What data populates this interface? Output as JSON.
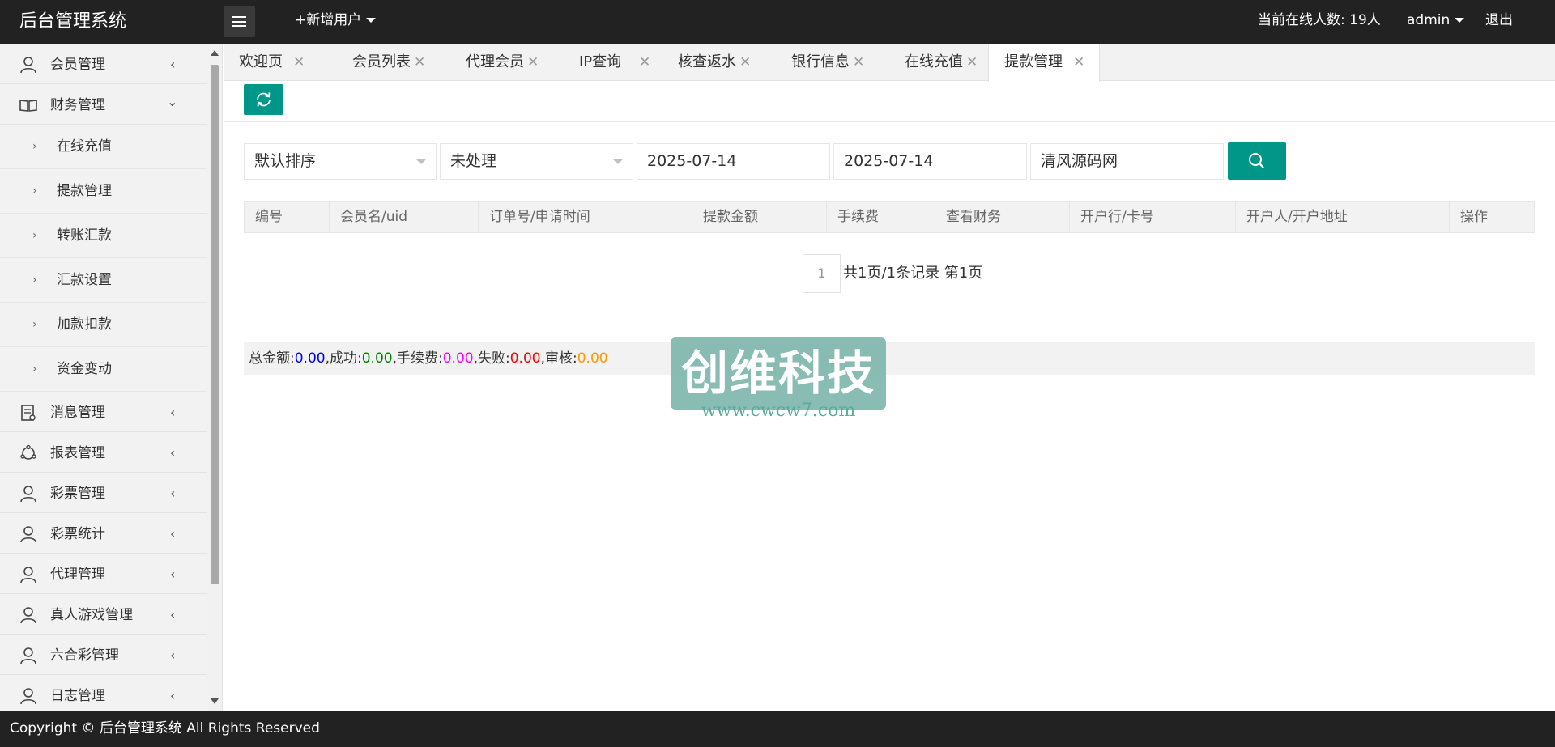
{
  "header": {
    "logo": "后台管理系统",
    "add_user": "+新增用户",
    "online_count": "当前在线人数: 19人",
    "admin": "admin",
    "logout": "退出"
  },
  "sidebar": {
    "items": [
      {
        "label": "会员管理",
        "icon": "user-icon"
      },
      {
        "label": "财务管理",
        "icon": "book-icon"
      },
      {
        "label": "消息管理",
        "icon": "document-icon"
      },
      {
        "label": "报表管理",
        "icon": "cycle-icon"
      },
      {
        "label": "彩票管理",
        "icon": "user-icon"
      },
      {
        "label": "彩票统计",
        "icon": "user-icon"
      },
      {
        "label": "代理管理",
        "icon": "user-icon"
      },
      {
        "label": "真人游戏管理",
        "icon": "user-icon"
      },
      {
        "label": "六合彩管理",
        "icon": "user-icon"
      },
      {
        "label": "日志管理",
        "icon": "user-icon"
      }
    ],
    "finance_sub": [
      "在线充值",
      "提款管理",
      "转账汇款",
      "汇款设置",
      "加款扣款",
      "资金变动"
    ]
  },
  "tabs": [
    "欢迎页",
    "会员列表",
    "代理会员",
    "IP查询",
    "核查返水",
    "银行信息",
    "在线充值",
    "提款管理"
  ],
  "active_tab": "提款管理",
  "filters": {
    "sort": "默认排序",
    "status": "未处理",
    "date_start": "2025-07-14",
    "date_end": "2025-07-14",
    "keyword": "清风源码网"
  },
  "table": {
    "columns": [
      "编号",
      "会员名/uid",
      "订单号/申请时间",
      "提款金额",
      "手续费",
      "查看财务",
      "开户行/卡号",
      "开户人/开户地址",
      "操作"
    ]
  },
  "pager": {
    "current": "1",
    "summary": "共1页/1条记录 第1页"
  },
  "summary": {
    "total_label": "总金额:",
    "total": "0.00",
    "success_label": ",成功:",
    "success": "0.00",
    "fee_label": ",手续费:",
    "fee": "0.00",
    "fail_label": ",失败:",
    "fail": "0.00",
    "review_label": ",审核:",
    "review": "0.00",
    "colors": {
      "total": "#0000ff",
      "success": "#008000",
      "fee": "#ff00ff",
      "fail": "#ff0000",
      "review": "#ff9900"
    }
  },
  "watermark": {
    "title": "创维科技",
    "url": "www.cwcw7.com"
  },
  "footer": "Copyright © 后台管理系统 All Rights Reserved",
  "colors": {
    "accent": "#009688",
    "header_bg": "#222222"
  }
}
